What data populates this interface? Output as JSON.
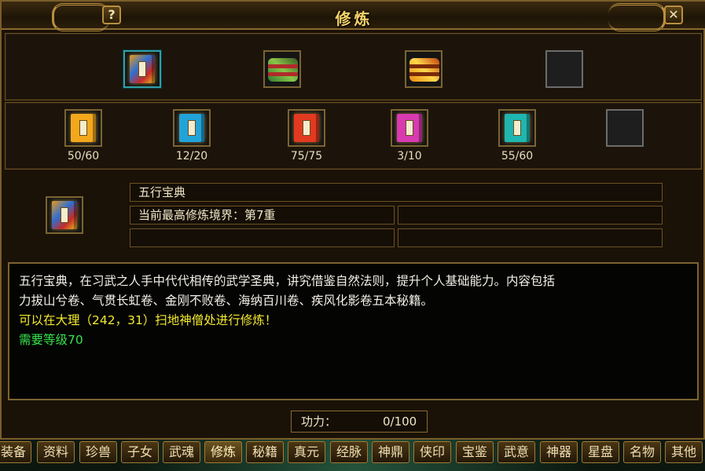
{
  "window": {
    "title": "修炼",
    "help_label": "?",
    "close_label": "✕"
  },
  "top_slots": [
    {
      "icon": "wuxing-book-icon",
      "selected": true
    },
    {
      "icon": "scroll-bundle-green-icon"
    },
    {
      "icon": "scroll-bundle-gold-icon"
    },
    {
      "icon": "empty-slot"
    }
  ],
  "books": [
    {
      "icon": "yellow-book-icon",
      "color": "#f2a81c",
      "count": "50/60"
    },
    {
      "icon": "blue-book-icon",
      "color": "#22a3d8",
      "count": "12/20"
    },
    {
      "icon": "red-book-icon",
      "color": "#e23a20",
      "count": "75/75"
    },
    {
      "icon": "pink-book-icon",
      "color": "#d83ab0",
      "count": "3/10"
    },
    {
      "icon": "teal-book-icon",
      "color": "#1eb6b0",
      "count": "55/60"
    },
    {
      "icon": "empty-slot",
      "color": "",
      "count": ""
    }
  ],
  "selected": {
    "icon": "wuxing-book-icon",
    "name": "五行宝典",
    "realm": "当前最高修炼境界：第7重"
  },
  "description": {
    "line1": "五行宝典，在习武之人手中代代相传的武学圣典，讲究借鉴自然法则，提升个人基础能力。内容包括",
    "line2": "力拔山兮卷、气贯长虹卷、金刚不败卷、海纳百川卷、疾风化影卷五本秘籍。",
    "location": "可以在大理（242，31）扫地神僧处进行修炼！",
    "level_req": "需要等级70"
  },
  "power": {
    "label": "功力：",
    "value": "0/100"
  },
  "tabs": [
    "装备",
    "资料",
    "珍兽",
    "子女",
    "武魂",
    "修炼",
    "秘籍",
    "真元",
    "经脉",
    "神鼎",
    "侠印",
    "宝鉴",
    "武意",
    "神器",
    "星盘",
    "名物",
    "其他"
  ],
  "active_tab": "修炼",
  "colors": {
    "title": "#f6d36a",
    "frame": "#7a5d2a",
    "desc_yellow": "#f3ea2d",
    "desc_green": "#35e24c"
  }
}
